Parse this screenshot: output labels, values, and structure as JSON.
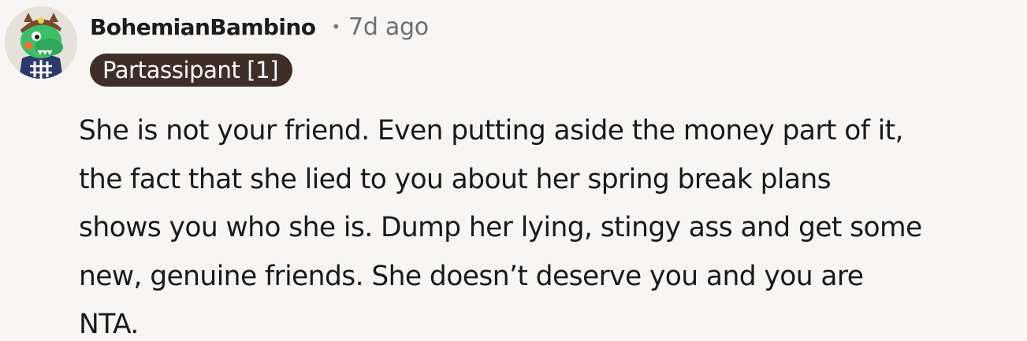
{
  "comment": {
    "username": "BohemianBambino",
    "separator": "•",
    "timestamp": "7d ago",
    "flair": "Partassipant [1]",
    "avatar": "avatar-icon",
    "body_lines": [
      "She is not your friend. Even putting aside the money part of it,",
      "the fact that she lied to you about her spring break plans",
      "shows you who she is. Dump her lying, stingy ass and get some",
      "new, genuine friends. She doesn’t deserve you and you are",
      "NTA."
    ]
  },
  "colors": {
    "background": "#f7f6f4",
    "flair_background": "#3f2e26",
    "flair_text": "#ffffff",
    "meta_text": "#6e6e6e"
  }
}
